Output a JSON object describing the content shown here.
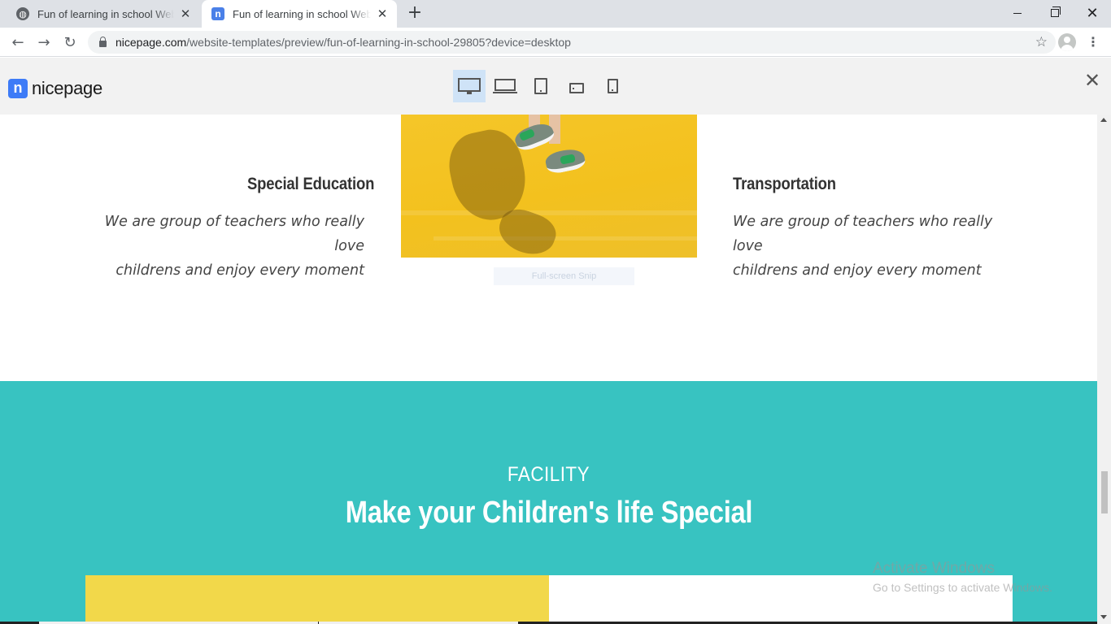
{
  "browser": {
    "tabs": [
      {
        "title": "Fun of learning in school Website Template",
        "active": false,
        "icon": "globe-icon"
      },
      {
        "title": "Fun of learning in school Website Template",
        "active": true,
        "icon": "nicepage-icon"
      }
    ],
    "new_tab": "+",
    "url_host": "nicepage.com",
    "url_path": "/website-templates/preview/fun-of-learning-in-school-29805?device=desktop"
  },
  "preview_bar": {
    "logo_mark": "n",
    "logo_text": "nicepage",
    "devices": [
      {
        "name": "desktop",
        "selected": true
      },
      {
        "name": "laptop",
        "selected": false
      },
      {
        "name": "tablet",
        "selected": false
      },
      {
        "name": "tablet-landscape",
        "selected": false
      },
      {
        "name": "phone",
        "selected": false
      }
    ]
  },
  "services": {
    "left": {
      "title": "Special Education",
      "description_line1": "We are group of teachers who really love",
      "description_line2": "childrens and enjoy every moment"
    },
    "right": {
      "title": "Transportation",
      "description_line1": "We are group of teachers who really love",
      "description_line2": "childrens and enjoy every moment"
    }
  },
  "overlay": {
    "snip_label": "Full-screen Snip"
  },
  "facility": {
    "kicker": "FACILITY",
    "heading": "Make your Children's life Special"
  },
  "watermark": {
    "title": "Activate Windows",
    "subtitle": "Go to Settings to activate Windows."
  },
  "colors": {
    "facility_bg": "#38c3c1",
    "photo_yellow": "#f3c11e",
    "card_yellow": "#f2d84a",
    "accent_blue": "#3d7bf7"
  }
}
